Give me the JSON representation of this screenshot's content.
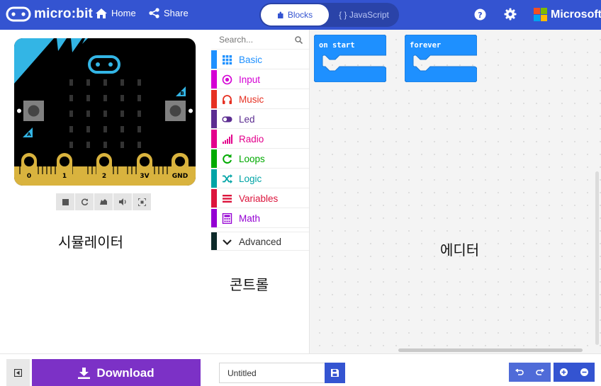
{
  "header": {
    "logo_text": "micro:bit",
    "home_label": "Home",
    "share_label": "Share",
    "blocks_label": "Blocks",
    "javascript_label": "{ } JavaScript",
    "microsoft_label": "Microsoft"
  },
  "simulator": {
    "pins": [
      "0",
      "1",
      "2",
      "3V",
      "GND"
    ],
    "button_a": "A",
    "button_b": "B",
    "caption": "시뮬레이터"
  },
  "toolbox": {
    "search_placeholder": "Search...",
    "categories": [
      {
        "label": "Basic",
        "color": "#1e90ff",
        "icon": "grid-icon"
      },
      {
        "label": "Input",
        "color": "#d400d4",
        "icon": "target-icon"
      },
      {
        "label": "Music",
        "color": "#e63022",
        "icon": "headphones-icon"
      },
      {
        "label": "Led",
        "color": "#5c2d91",
        "icon": "toggle-icon"
      },
      {
        "label": "Radio",
        "color": "#e3008c",
        "icon": "signal-icon"
      },
      {
        "label": "Loops",
        "color": "#00aa00",
        "icon": "refresh-icon"
      },
      {
        "label": "Logic",
        "color": "#00a4a6",
        "icon": "shuffle-icon"
      },
      {
        "label": "Variables",
        "color": "#dc143c",
        "icon": "list-icon"
      },
      {
        "label": "Math",
        "color": "#9400d3",
        "icon": "calculator-icon"
      }
    ],
    "advanced_label": "Advanced",
    "advanced_color": "#0d2a2a",
    "caption": "콘트롤"
  },
  "editor": {
    "on_start_label": "on start",
    "forever_label": "forever",
    "block_color": "#1e90ff",
    "caption": "에디터"
  },
  "bottombar": {
    "download_label": "Download",
    "project_name": "Untitled"
  }
}
